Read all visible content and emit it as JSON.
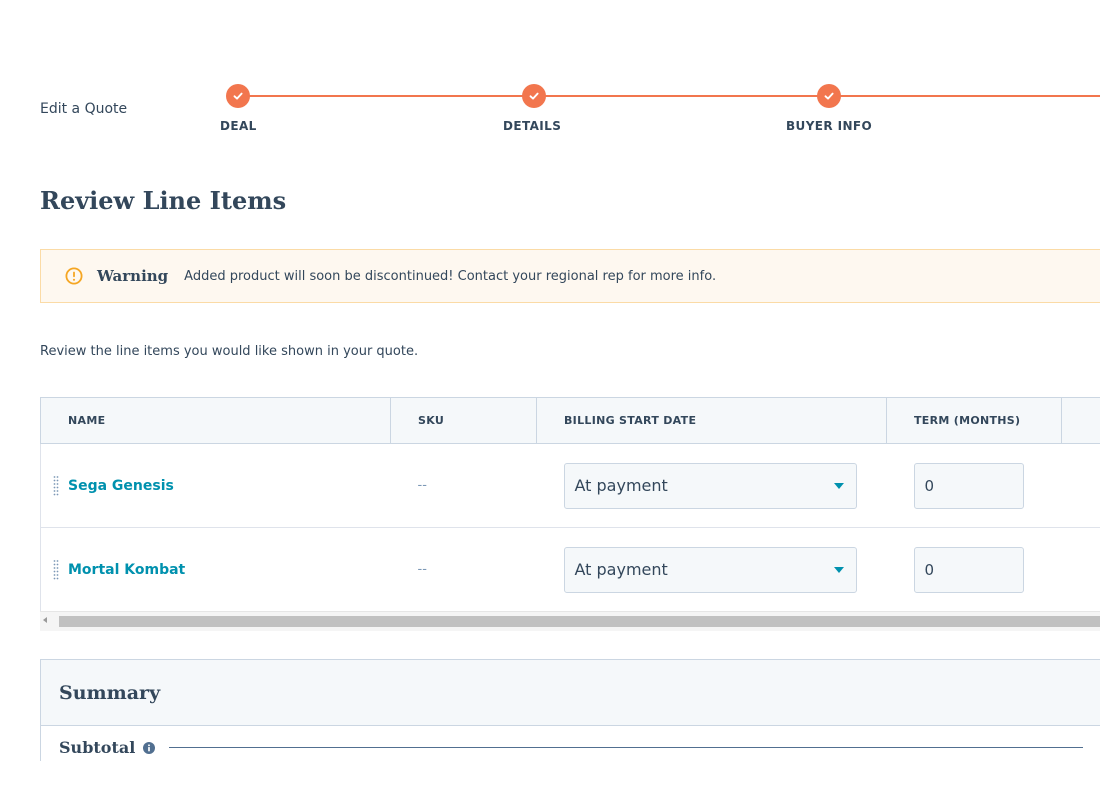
{
  "header": {
    "edit_title": "Edit a Quote"
  },
  "stepper": {
    "steps": [
      {
        "label": "DEAL",
        "status": "complete",
        "icon": "check-icon"
      },
      {
        "label": "DETAILS",
        "status": "complete",
        "icon": "check-icon"
      },
      {
        "label": "BUYER INFO",
        "status": "complete",
        "icon": "check-icon"
      }
    ],
    "accent_color": "#f2764e"
  },
  "main": {
    "title": "Review Line Items",
    "intro": "Review the line items you would like shown in your quote."
  },
  "alert": {
    "icon": "warning-circle-icon",
    "title": "Warning",
    "message": "Added product will soon be discontinued! Contact your regional rep for more info.",
    "color": "#f5a623"
  },
  "table": {
    "columns": [
      {
        "label": "NAME"
      },
      {
        "label": "SKU"
      },
      {
        "label": "BILLING START DATE"
      },
      {
        "label": "TERM (MONTHS)"
      }
    ],
    "rows": [
      {
        "name": "Sega Genesis",
        "sku": "--",
        "billing_start": "At payment",
        "term": "0"
      },
      {
        "name": "Mortal Kombat",
        "sku": "--",
        "billing_start": "At payment",
        "term": "0"
      }
    ],
    "link_color": "#0091ae"
  },
  "summary": {
    "title": "Summary",
    "subtotal_label": "Subtotal",
    "info_icon": "info-icon"
  }
}
